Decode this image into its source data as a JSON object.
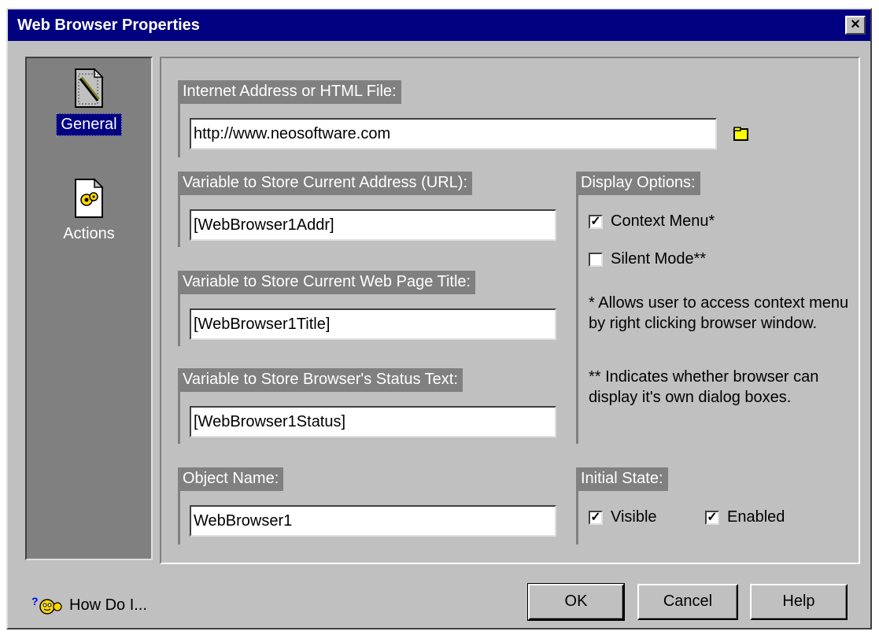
{
  "window": {
    "title": "Web Browser Properties"
  },
  "sidebar": {
    "items": [
      {
        "label": "General",
        "icon": "general-properties-icon",
        "selected": true
      },
      {
        "label": "Actions",
        "icon": "actions-gear-icon",
        "selected": false
      }
    ]
  },
  "general": {
    "address": {
      "label": "Internet Address or HTML File:",
      "value": "http://www.neosoftware.com"
    },
    "url_var": {
      "label": "Variable to Store Current Address (URL):",
      "value": "[WebBrowser1Addr]"
    },
    "title_var": {
      "label": "Variable to Store Current Web Page Title:",
      "value": "[WebBrowser1Title]"
    },
    "status_var": {
      "label": "Variable to Store Browser's Status Text:",
      "value": "[WebBrowser1Status]"
    },
    "object_name": {
      "label": "Object Name:",
      "value": "WebBrowser1"
    }
  },
  "display_options": {
    "label": "Display Options:",
    "context_menu": {
      "label": "Context Menu*",
      "checked": true
    },
    "silent_mode": {
      "label": "Silent Mode**",
      "checked": false
    },
    "note1": "* Allows user to access context menu by right clicking browser window.",
    "note2": "** Indicates whether browser can display it's own dialog boxes."
  },
  "initial_state": {
    "label": "Initial State:",
    "visible": {
      "label": "Visible",
      "checked": true
    },
    "enabled": {
      "label": "Enabled",
      "checked": true
    }
  },
  "footer": {
    "how_do_i": "How Do I...",
    "ok": "OK",
    "cancel": "Cancel",
    "help": "Help"
  },
  "colors": {
    "titlebar": "#000080",
    "face": "#c0c0c0",
    "group_label": "#808080"
  }
}
